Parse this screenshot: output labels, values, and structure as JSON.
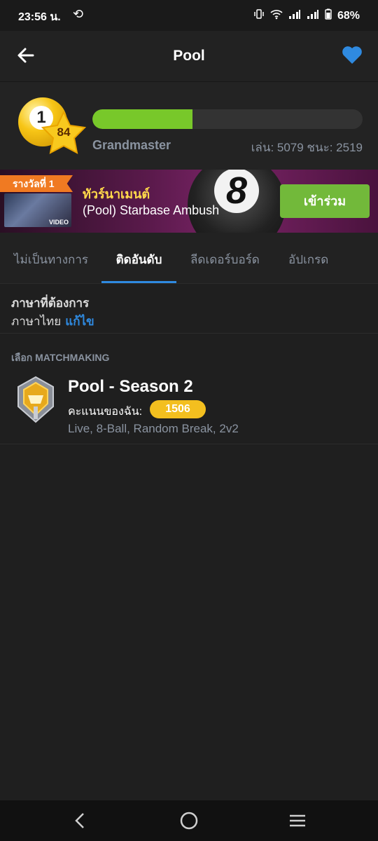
{
  "status": {
    "time": "23:56 น.",
    "battery": "68%"
  },
  "header": {
    "title": "Pool"
  },
  "profile": {
    "level_ball": "1",
    "level": "84",
    "progress_pct": 37,
    "rank": "Grandmaster",
    "stats": "เล่น: 5079  ชนะ: 2519"
  },
  "banner": {
    "ribbon": "รางวัลที่ 1",
    "video_label": "VIDEO",
    "title": "ทัวร์นาเมนต์",
    "subtitle": "(Pool) Starbase Ambush",
    "join_label": "เข้าร่วม",
    "ball_number": "8"
  },
  "tabs": [
    {
      "label": "ไม่เป็นทางการ"
    },
    {
      "label": "ติดอันดับ",
      "active": true
    },
    {
      "label": "ลีดเดอร์บอร์ด"
    },
    {
      "label": "อัปเกรด"
    }
  ],
  "language": {
    "label": "ภาษาที่ต้องการ",
    "value": "ภาษาไทย",
    "edit_label": "แก้ไข"
  },
  "section_title": "เลือก MATCHMAKING",
  "matchmaking": {
    "name": "Pool - Season 2",
    "score_label": "คะแนนของฉัน:",
    "score": "1506",
    "description": "Live, 8-Ball, Random Break, 2v2"
  },
  "colors": {
    "accent": "#2f8ae0",
    "progress": "#78c82a",
    "join": "#72b93a",
    "score_badge": "#f3bf1f"
  }
}
